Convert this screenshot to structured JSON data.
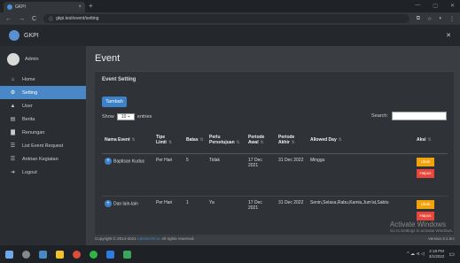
{
  "browser": {
    "tab_title": "GKPI",
    "tab_close": "×",
    "new_tab": "+",
    "window_controls": [
      "—",
      "▢",
      "✕"
    ],
    "nav": {
      "back": "←",
      "forward": "→",
      "reload": "C"
    },
    "url": "gkpi.test/event/setting",
    "extension_icons": [
      "⧉",
      "☆",
      "◐",
      "⋮"
    ]
  },
  "app": {
    "name": "GKPI",
    "close_icon": "✕"
  },
  "sidebar": {
    "user_name": "Admin",
    "items": [
      {
        "label": "Home",
        "icon": "home-icon",
        "glyph": "⌂",
        "active": false
      },
      {
        "label": "Setting",
        "icon": "gear-icon",
        "glyph": "⚙",
        "active": true
      },
      {
        "label": "User",
        "icon": "user-icon",
        "glyph": "▲",
        "active": false
      },
      {
        "label": "Berita",
        "icon": "news-icon",
        "glyph": "▤",
        "active": false
      },
      {
        "label": "Renungan",
        "icon": "book-icon",
        "glyph": "▇",
        "active": false
      },
      {
        "label": "List Event Request",
        "icon": "list-icon",
        "glyph": "☰",
        "active": false
      },
      {
        "label": "Antrian Kegiatan",
        "icon": "queue-icon",
        "glyph": "☰",
        "active": false
      },
      {
        "label": "Logout",
        "icon": "logout-icon",
        "glyph": "➜",
        "active": false
      }
    ]
  },
  "main": {
    "page_title": "Event",
    "card_title": "Event Setting",
    "add_button": "Tambah",
    "show_label": "Show",
    "show_value": "10 ÷",
    "entries_label": "entries",
    "search_label": "Search:",
    "table": {
      "headers": [
        "Nama Event",
        "Tipe Limit",
        "Batas",
        "Perlu Persetujuan",
        "Periode Awal",
        "Periode Akhir",
        "Allowed Day",
        "Aksi"
      ],
      "rows": [
        {
          "nama": "Baptisan Kudus",
          "tipe": "Per Hari",
          "batas": "5",
          "perlu": "Tidak",
          "awal": "17 Dec 2021",
          "akhir": "31 Dec 2022",
          "allowed": "Minggu",
          "ubah": "Ubah",
          "hapus": "Hapus"
        },
        {
          "nama": "Dan lain-lain",
          "tipe": "Per Hari",
          "batas": "1",
          "perlu": "Ya",
          "awal": "17 Dec 2021",
          "akhir": "31 Dec 2022",
          "allowed": "Senin,Selasa,Rabu,Kamis,Jum'at,Sabtu",
          "ubah": "Ubah",
          "hapus": "Hapus"
        }
      ]
    },
    "footer_prefix": "Copyright © 2014-2021",
    "footer_link": "AdminLTE.io.",
    "footer_suffix": "All rights reserved.",
    "version": "Version 3.1.0rc",
    "watermark_title": "Activate Windows",
    "watermark_sub": "Go to Settings to activate Windows."
  },
  "taskbar": {
    "time": "2:18 PM",
    "date": "3/1/2022",
    "tray_text": "^ ☁ ⊲ ◁"
  },
  "colors": {
    "accent": "#3c82c8",
    "sidebar_active": "#4a87c6",
    "warning": "#f0a30a",
    "danger": "#e8463a"
  }
}
